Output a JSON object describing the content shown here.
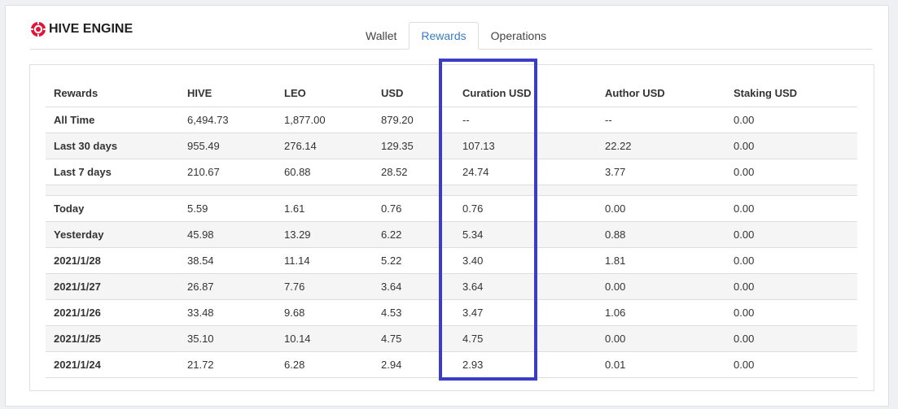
{
  "brand": {
    "name": "HIVE ENGINE",
    "accent": "#e31337"
  },
  "tabs": [
    {
      "label": "Wallet",
      "active": false
    },
    {
      "label": "Rewards",
      "active": true
    },
    {
      "label": "Operations",
      "active": false
    }
  ],
  "colors": {
    "active_tab": "#3a7cc4",
    "highlight_box": "#3b3dc4"
  },
  "highlight": {
    "column": "Curation USD"
  },
  "table": {
    "headers": [
      "Rewards",
      "HIVE",
      "LEO",
      "USD",
      "Curation USD",
      "Author USD",
      "Staking USD"
    ],
    "summary_rows": [
      [
        "All Time",
        "6,494.73",
        "1,877.00",
        "879.20",
        "--",
        "--",
        "0.00"
      ],
      [
        "Last 30 days",
        "955.49",
        "276.14",
        "129.35",
        "107.13",
        "22.22",
        "0.00"
      ],
      [
        "Last 7 days",
        "210.67",
        "60.88",
        "28.52",
        "24.74",
        "3.77",
        "0.00"
      ]
    ],
    "daily_rows": [
      [
        "Today",
        "5.59",
        "1.61",
        "0.76",
        "0.76",
        "0.00",
        "0.00"
      ],
      [
        "Yesterday",
        "45.98",
        "13.29",
        "6.22",
        "5.34",
        "0.88",
        "0.00"
      ],
      [
        "2021/1/28",
        "38.54",
        "11.14",
        "5.22",
        "3.40",
        "1.81",
        "0.00"
      ],
      [
        "2021/1/27",
        "26.87",
        "7.76",
        "3.64",
        "3.64",
        "0.00",
        "0.00"
      ],
      [
        "2021/1/26",
        "33.48",
        "9.68",
        "4.53",
        "3.47",
        "1.06",
        "0.00"
      ],
      [
        "2021/1/25",
        "35.10",
        "10.14",
        "4.75",
        "4.75",
        "0.00",
        "0.00"
      ],
      [
        "2021/1/24",
        "21.72",
        "6.28",
        "2.94",
        "2.93",
        "0.01",
        "0.00"
      ]
    ]
  }
}
